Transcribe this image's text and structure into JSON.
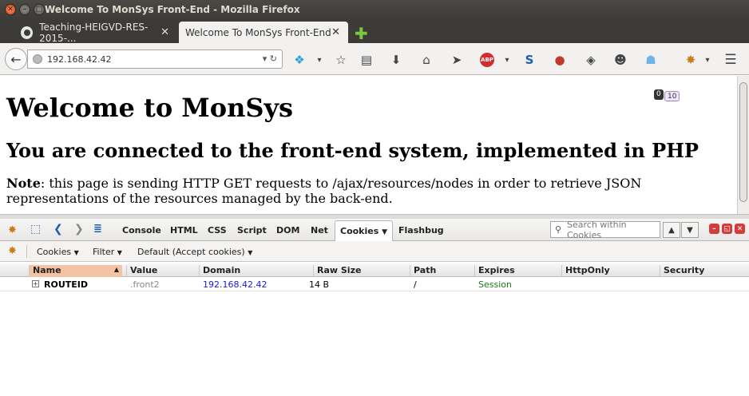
{
  "window": {
    "title": "Welcome To MonSys Front-End - Mozilla Firefox"
  },
  "tabs": [
    {
      "label": "Teaching-HEIGVD-RES-2015-..."
    },
    {
      "label": "Welcome To MonSys Front-End"
    }
  ],
  "navbar": {
    "url": "192.168.42.42",
    "badge_count": "0",
    "badge_count2": "10"
  },
  "page": {
    "h1": "Welcome to MonSys",
    "h2": "You are connected to the front-end system, implemented in PHP",
    "note_label": "Note",
    "note_text": ": this page is sending HTTP GET requests to /ajax/resources/nodes in order to retrieve JSON representations of the resources managed by the back-end."
  },
  "firebug": {
    "tabs": [
      "Console",
      "HTML",
      "CSS",
      "Script",
      "DOM",
      "Net",
      "Cookies",
      "Flashbug"
    ],
    "active_tab": "Cookies",
    "search_placeholder": "Search within Cookies",
    "subbar": {
      "cookies": "Cookies",
      "filter": "Filter",
      "default": "Default (Accept cookies)"
    },
    "columns": [
      "Name",
      "Value",
      "Domain",
      "Raw Size",
      "Path",
      "Expires",
      "HttpOnly",
      "Security"
    ],
    "rows": [
      {
        "name": "ROUTEID",
        "value": ".front2",
        "domain": "192.168.42.42",
        "raw_size": "14 B",
        "path": "/",
        "expires": "Session",
        "httponly": "",
        "security": ""
      }
    ]
  }
}
